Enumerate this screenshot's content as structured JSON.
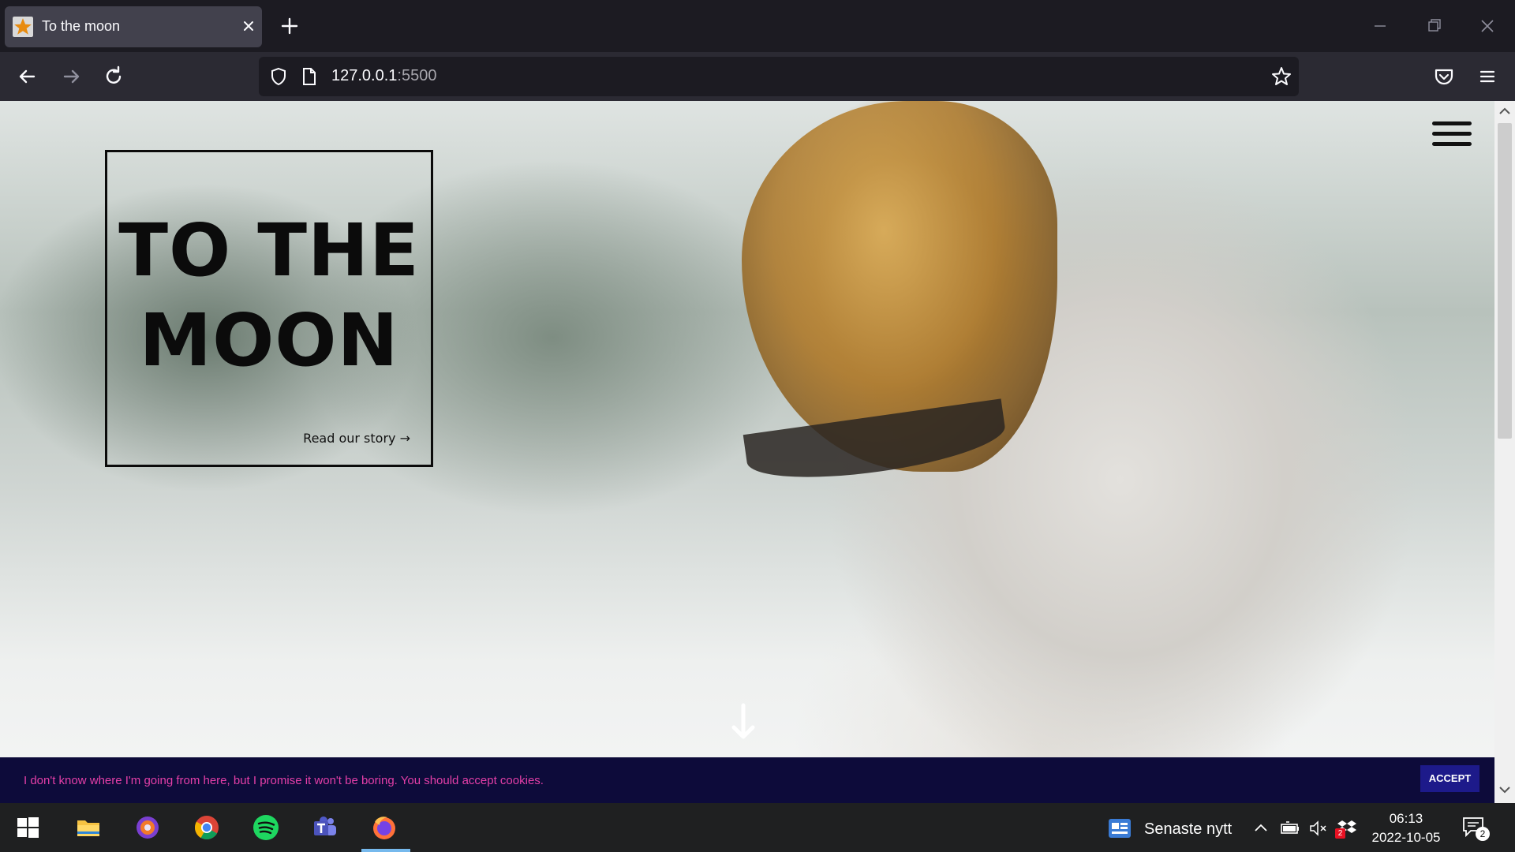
{
  "browser": {
    "tab": {
      "title": "To the moon",
      "favicon": "star-icon"
    },
    "url": {
      "host": "127.0.0.1",
      "port": ":5500"
    }
  },
  "page": {
    "hero": {
      "title_line1": "TO THE",
      "title_line2": "MOON",
      "read_story": "Read our story →"
    },
    "cookie_banner": {
      "message": "I don't know where I'm going from here, but I promise it won't be boring. You should accept cookies.",
      "accept_label": "ACCEPT"
    },
    "colors": {
      "cookie_bg": "#0d0b3a",
      "cookie_text": "#e53fa8",
      "accept_bg": "#1d1a8a"
    }
  },
  "taskbar": {
    "apps": [
      "windows-start-icon",
      "file-explorer-icon",
      "edge-canary-icon",
      "chrome-icon",
      "spotify-icon",
      "teams-icon",
      "firefox-icon"
    ],
    "news_label": "Senaste nytt",
    "time": "06:13",
    "date": "2022-10-05",
    "notification_count": "2",
    "dropbox_badge": "2"
  }
}
